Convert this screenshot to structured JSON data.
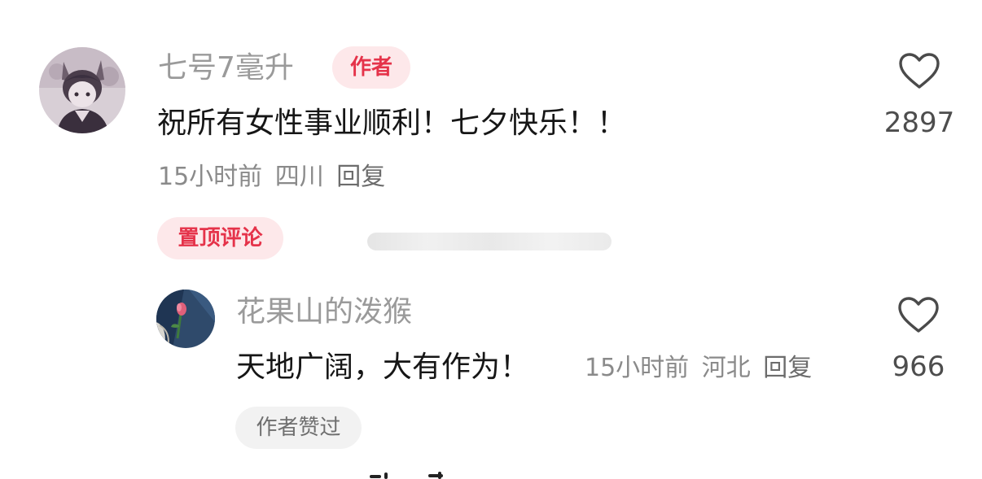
{
  "colors": {
    "accent_red": "#e5334a",
    "tag_pink_bg": "#fde8ea",
    "muted_gray": "#9a9a9a"
  },
  "main_comment": {
    "username": "七号7毫升",
    "author_tag": "作者",
    "text": "祝所有女性事业顺利！七夕快乐！！",
    "meta": {
      "time": "15小时前",
      "location": "四川",
      "reply": "回复"
    },
    "pin_tag": "置顶评论",
    "like_icon": "heart-outline-icon",
    "like_count": "2897"
  },
  "reply_comment": {
    "username": "花果山的泼猴",
    "text": "天地广阔，大有作为！",
    "meta": {
      "time": "15小时前",
      "location": "河北",
      "reply": "回复"
    },
    "liked_tag": "作者赞过",
    "like_icon": "heart-outline-icon",
    "like_count": "966"
  }
}
